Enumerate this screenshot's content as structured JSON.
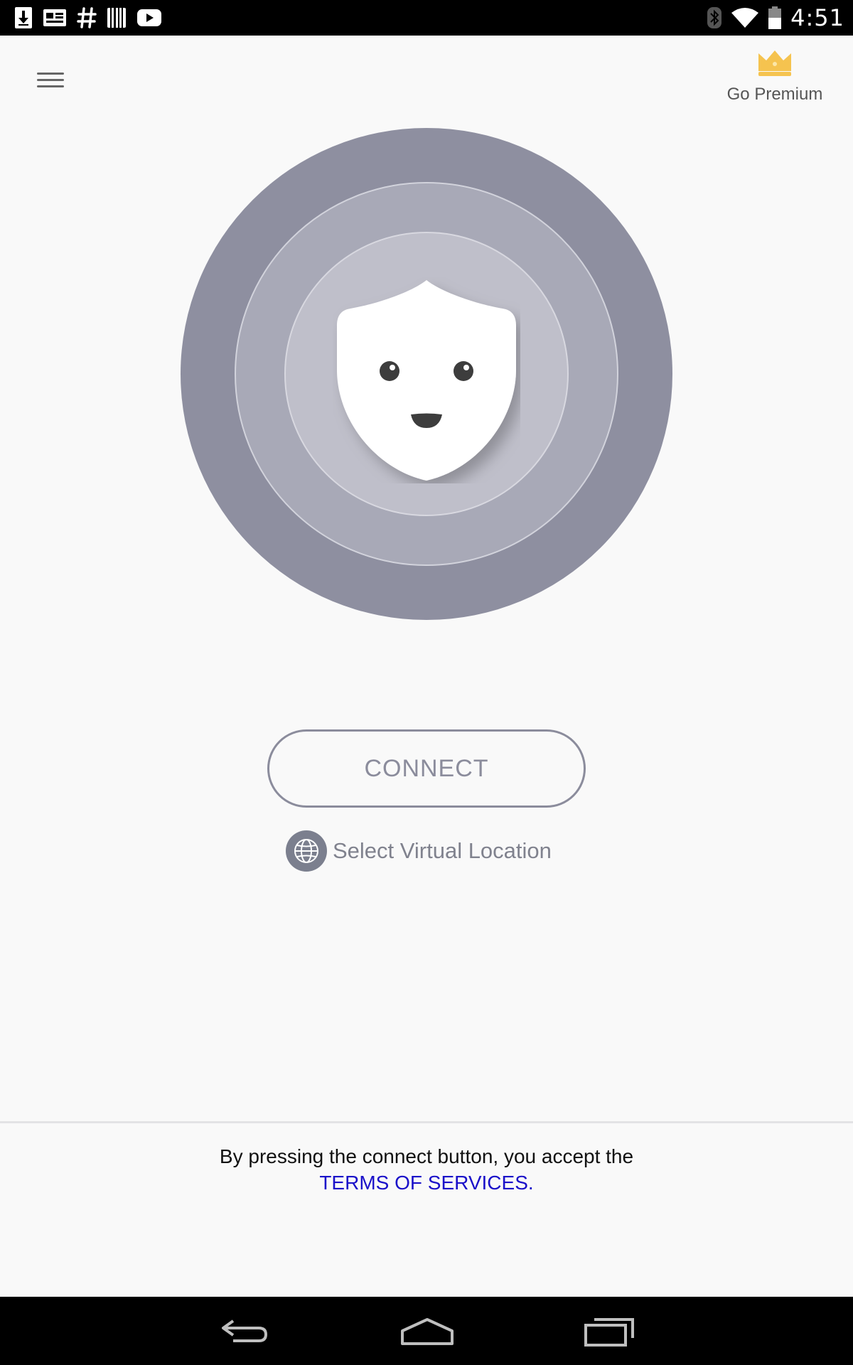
{
  "status_bar": {
    "time": "4:51",
    "left_icons": [
      "download-icon",
      "news-icon",
      "hash-icon",
      "barcode-icon",
      "youtube-icon"
    ],
    "right_icons": [
      "bluetooth-icon",
      "wifi-icon",
      "battery-icon"
    ]
  },
  "header": {
    "menu_icon": "hamburger-menu-icon",
    "premium_label": "Go Premium",
    "premium_icon": "crown-icon",
    "crown_color": "#f5c34f"
  },
  "main": {
    "connect_label": "CONNECT",
    "location_label": "Select Virtual Location",
    "location_icon": "globe-icon"
  },
  "footer": {
    "terms_text": "By pressing the connect button, you accept the",
    "terms_link": "TERMS OF SERVICES.",
    "link_color": "#1a10c9"
  },
  "nav_bar": {
    "buttons": [
      "back-icon",
      "home-icon",
      "recents-icon"
    ]
  }
}
